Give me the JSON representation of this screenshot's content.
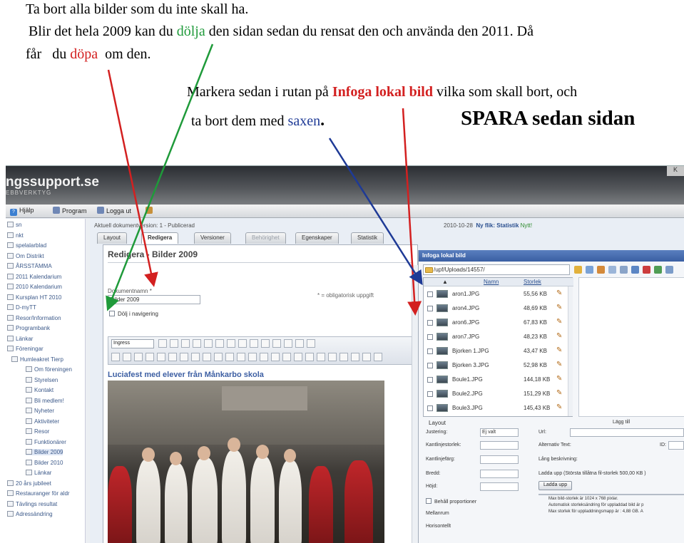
{
  "instructions": {
    "line1": "Ta bort alla bilder som du inte skall ha.",
    "line2_a": "Blir det hela 2009 kan du ",
    "line2_green": "dölja",
    "line2_b": " den sidan sedan du rensat den och använda den 2011. Då",
    "line3_a": "får   du ",
    "line3_red": "döpa",
    "line3_b": "  om den.",
    "line4_a": "Markera sedan i rutan på ",
    "line4_red": "Infoga lokal bild",
    "line4_b": " vilka som skall bort, och",
    "line5_a": "ta bort dem med ",
    "line5_blue": "saxen",
    "line5_dot": ".",
    "line5_big": "SPARA sedan sidan"
  },
  "app": {
    "logo": "ngssupport.se",
    "logo_sub": "EBBVERKTYG",
    "corner": "K",
    "menu": [
      {
        "label": "Hjälp",
        "icon": "question-icon"
      },
      {
        "label": "Program",
        "icon": "program-icon"
      },
      {
        "label": "Logga ut",
        "icon": "logout-icon"
      }
    ]
  },
  "sidebar": {
    "items": [
      {
        "label": "sn",
        "hl": false
      },
      {
        "label": "nkt",
        "hl": false
      },
      {
        "label": "spelalarblad",
        "hl": false
      },
      {
        "label": "Om Distrikt",
        "hl": false
      },
      {
        "label": "ÅRSSTÄMMA",
        "hl": false
      },
      {
        "label": "2011 Kalendarium",
        "hl": false
      },
      {
        "label": "2010 Kalendarium",
        "hl": false
      },
      {
        "label": "Kursplan HT 2010",
        "hl": false
      },
      {
        "label": "D-myTT",
        "hl": false
      },
      {
        "label": "Resor/Information",
        "hl": false
      },
      {
        "label": "Programbank",
        "hl": false
      },
      {
        "label": "Länkar",
        "hl": false
      },
      {
        "label": "Föreningar",
        "hl": false
      },
      {
        "label": "Humleakret Tierp",
        "hl": false
      },
      {
        "label": "Om föreningen",
        "hl": false
      },
      {
        "label": "Styrelsen",
        "hl": false
      },
      {
        "label": "Kontakt",
        "hl": false
      },
      {
        "label": "Bli medlem!",
        "hl": false
      },
      {
        "label": "Nyheter",
        "hl": false
      },
      {
        "label": "Aktiviteter",
        "hl": false
      },
      {
        "label": "Resor",
        "hl": false
      },
      {
        "label": "Funktionärer",
        "hl": false
      },
      {
        "label": "Bilder 2009",
        "hl": true
      },
      {
        "label": "Bilder 2010",
        "hl": false
      },
      {
        "label": "Länkar",
        "hl": false
      },
      {
        "label": "20 års jubileet",
        "hl": false
      },
      {
        "label": "Restauranger för aldr",
        "hl": false
      },
      {
        "label": "Tävlings resultat",
        "hl": false
      },
      {
        "label": "Adressändring",
        "hl": false
      }
    ]
  },
  "editor_header": {
    "version": "Aktuell dokumentversion: 1 - Publicerad",
    "date": "2010-10-28",
    "date_link": "Ny flik: Statistik",
    "date_new": "Nytt!"
  },
  "tabs": [
    {
      "label": "Layout",
      "state": "normal"
    },
    {
      "label": "Redigera",
      "state": "active"
    },
    {
      "label": "Versioner",
      "state": "normal"
    },
    {
      "label": "Behörighet",
      "state": "disabled"
    },
    {
      "label": "Egenskaper",
      "state": "normal"
    },
    {
      "label": "Statistik",
      "state": "normal"
    }
  ],
  "editor": {
    "title": "Redigera  -  Bilder 2009",
    "doc_name_label": "Dokumentnamn *",
    "doc_name_value": "Bilder 2009",
    "required_note": "* = obligatorisk uppgift",
    "hide_label": "Dölj i navigering",
    "format_select": "Ingress",
    "heading": "Luciafest med elever från Månkarbo skola"
  },
  "dialog": {
    "title": "Infoga lokal bild",
    "path": "/upf/Uploads/14557/",
    "col_name": "Namn",
    "col_size": "Storlek",
    "files": [
      {
        "name": "aron1.JPG",
        "size": "55,56 KB"
      },
      {
        "name": "aron4.JPG",
        "size": "48,69 KB"
      },
      {
        "name": "aron6.JPG",
        "size": "67,83 KB"
      },
      {
        "name": "aron7.JPG",
        "size": "48,23 KB"
      },
      {
        "name": "Bjorken 1.JPG",
        "size": "43,47 KB"
      },
      {
        "name": "Bjorken 3.JPG",
        "size": "52,98 KB"
      },
      {
        "name": "Boule1.JPG",
        "size": "144,18 KB"
      },
      {
        "name": "Boule2.JPG",
        "size": "151,29 KB"
      },
      {
        "name": "Boule3.JPG",
        "size": "145,43 KB"
      }
    ],
    "layout_title": "Layout",
    "layout_rows": [
      {
        "label": "Justering:",
        "value": "Ej valt"
      },
      {
        "label": "Kantlinjestorlek:",
        "value": ""
      },
      {
        "label": "Kantlinjefärg:",
        "value": ""
      },
      {
        "label": "Bredd:",
        "value": ""
      },
      {
        "label": "Höjd:",
        "value": ""
      }
    ],
    "keep_prop": "Behåll proportioner",
    "margin_label": "Mellanrum",
    "hmargin_label": "Horisontellt",
    "upload_title": "Lägg till",
    "url_label": "Url:",
    "alt_label": "Alternativ Text:",
    "id_label": "ID:",
    "long_desc_label": "Lång beskrivning:",
    "upload_hint": "Ladda upp (Största tillåtna fil-storlek 500,00 KB )",
    "upload_button": "Ladda upp",
    "notes": [
      "Max bild-storlek är 1024 x 768 pixlar.",
      "Automatisk storleksändring för uppladdad bild är p",
      "Max storlek för uppladdningsmapp är : 4,88 GB. A"
    ]
  },
  "colors": {
    "green": "#1f9a3a",
    "red": "#d32020",
    "navy": "#1e3a96"
  }
}
